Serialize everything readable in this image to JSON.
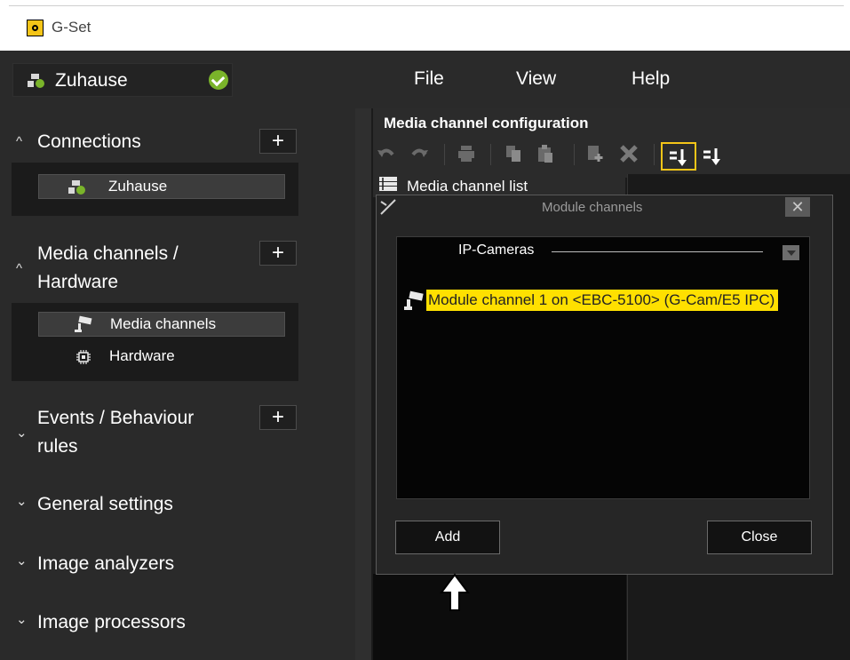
{
  "window": {
    "title": "G-Set"
  },
  "connection": {
    "name": "Zuhause",
    "status": "connected"
  },
  "menu": {
    "items": [
      "File",
      "View",
      "Help"
    ]
  },
  "sidebar": {
    "connections": {
      "title": "Connections",
      "add_label": "+",
      "items": [
        "Zuhause"
      ]
    },
    "media": {
      "title_line1": "Media channels /",
      "title_line2": "Hardware",
      "add_label": "+",
      "items": [
        "Media channels",
        "Hardware"
      ]
    },
    "events": {
      "title_line1": "Events / Behaviour",
      "title_line2": "rules",
      "add_label": "+"
    },
    "general": {
      "title": "General settings"
    },
    "analyzers": {
      "title": "Image analyzers"
    },
    "processors": {
      "title": "Image processors"
    }
  },
  "main": {
    "title": "Media channel configuration",
    "list_label": "Media channel list",
    "toolbar_icons": [
      "undo-icon",
      "redo-icon",
      "print-icon",
      "copy-icon",
      "paste-icon",
      "add-icon",
      "delete-icon",
      "sort-active-icon",
      "sort-icon"
    ]
  },
  "dialog": {
    "title": "Module channels",
    "close_glyph": "✕",
    "group_label": "IP-Cameras",
    "channel": "Module channel 1 on <EBC-5100> (G-Cam/E5 IPC)",
    "add_label": "Add",
    "close_label": "Close"
  },
  "colors": {
    "highlight": "#ffe000",
    "accent_border": "#f5c518",
    "status_ok": "#7ab42a",
    "background": "#1b1b1b"
  }
}
